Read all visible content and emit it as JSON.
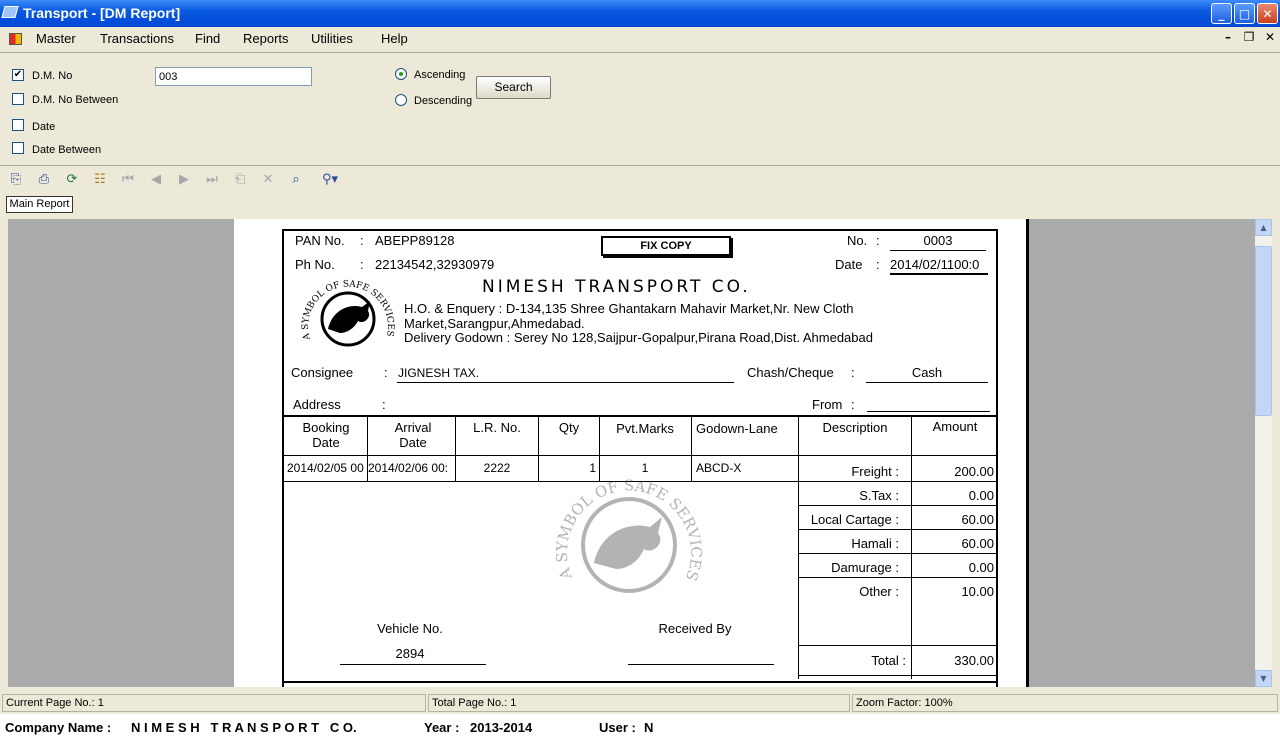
{
  "window": {
    "title": "Transport - [DM Report]",
    "minimize": "_",
    "maximize": "□",
    "close": "✕"
  },
  "menu": [
    "Master",
    "Transactions",
    "Find",
    "Reports",
    "Utilities",
    "Help"
  ],
  "mdi_controls": [
    "–",
    "❐",
    "✕"
  ],
  "filters": {
    "dm_no_label": "D.M. No",
    "dm_no_checked": true,
    "dm_no_value": "003",
    "dm_between_label": "D.M. No Between",
    "date_label": "Date",
    "date_between_label": "Date Between",
    "asc_label": "Ascending",
    "desc_label": "Descending",
    "search_label": "Search"
  },
  "toolbar": {
    "icons": [
      "export-icon",
      "print-icon",
      "refresh-icon",
      "group-tree-icon",
      "first-page-icon",
      "prev-page-icon",
      "next-page-icon",
      "last-page-icon",
      "goto-page-icon",
      "stop-icon",
      "search-text-icon",
      "zoom-icon"
    ]
  },
  "tab": {
    "main_report": "Main Report"
  },
  "report": {
    "pan_label": "PAN No.",
    "pan_value": "ABEPP89128",
    "ph_label": "Ph No.",
    "ph_value": "22134542,32930979",
    "colon": ":",
    "fix_copy": "FIX COPY",
    "no_label": "No.",
    "no_value": "0003",
    "date_label": "Date",
    "date_value": "2014/02/1100:0",
    "company": "NIMESH TRANSPORT CO.",
    "address1": "H.O. & Enquery : D-134,135 Shree Ghantakarn Mahavir Market,Nr. New Cloth",
    "address2": "Market,Sarangpur,Ahmedabad.",
    "address3": "Delivery Godown : Serey No 128,Saijpur-Gopalpur,Pirana Road,Dist. Ahmedabad",
    "logo_text": "A SYMBOL OF SAFE SERVICES",
    "consignee_label": "Consignee",
    "consignee_value": "JIGNESH TAX.",
    "cash_label": "Chash/Cheque",
    "cash_value": "Cash",
    "address_label": "Address",
    "from_label": "From",
    "headers": [
      "Booking Date",
      "Arrival Date",
      "L.R. No.",
      "Qty",
      "Pvt.Marks",
      "Godown-Lane",
      "Description",
      "Amount"
    ],
    "row": {
      "booking": "2014/02/05 00",
      "arrival": "2014/02/06 00:",
      "lr": "2222",
      "qty": "1",
      "marks": "1",
      "godown": "ABCD-X"
    },
    "charges": [
      {
        "label": "Freight :",
        "value": "200.00"
      },
      {
        "label": "S.Tax :",
        "value": "0.00"
      },
      {
        "label": "Local Cartage :",
        "value": "60.00"
      },
      {
        "label": "Hamali :",
        "value": "60.00"
      },
      {
        "label": "Damurage :",
        "value": "0.00"
      },
      {
        "label": "Other :",
        "value": "10.00"
      }
    ],
    "total_label": "Total :",
    "total_value": "330.00",
    "vehicle_label": "Vehicle No.",
    "vehicle_value": "2894",
    "received_label": "Received By"
  },
  "status": {
    "current_page": "Current Page No.: 1",
    "total_page": "Total Page No.: 1",
    "zoom": "Zoom Factor: 100%"
  },
  "footer": {
    "company_label": "Company Name :",
    "company_value": "N I M E S H   T R A N S P O R T   C O.",
    "year_label": "Year :",
    "year_value": "2013-2014",
    "user_label": "User :",
    "user_value": "N"
  },
  "colors": {
    "titlebar": "#0a5ae0",
    "chrome": "#ece9d8",
    "viewer_bg": "#abaaaa"
  }
}
